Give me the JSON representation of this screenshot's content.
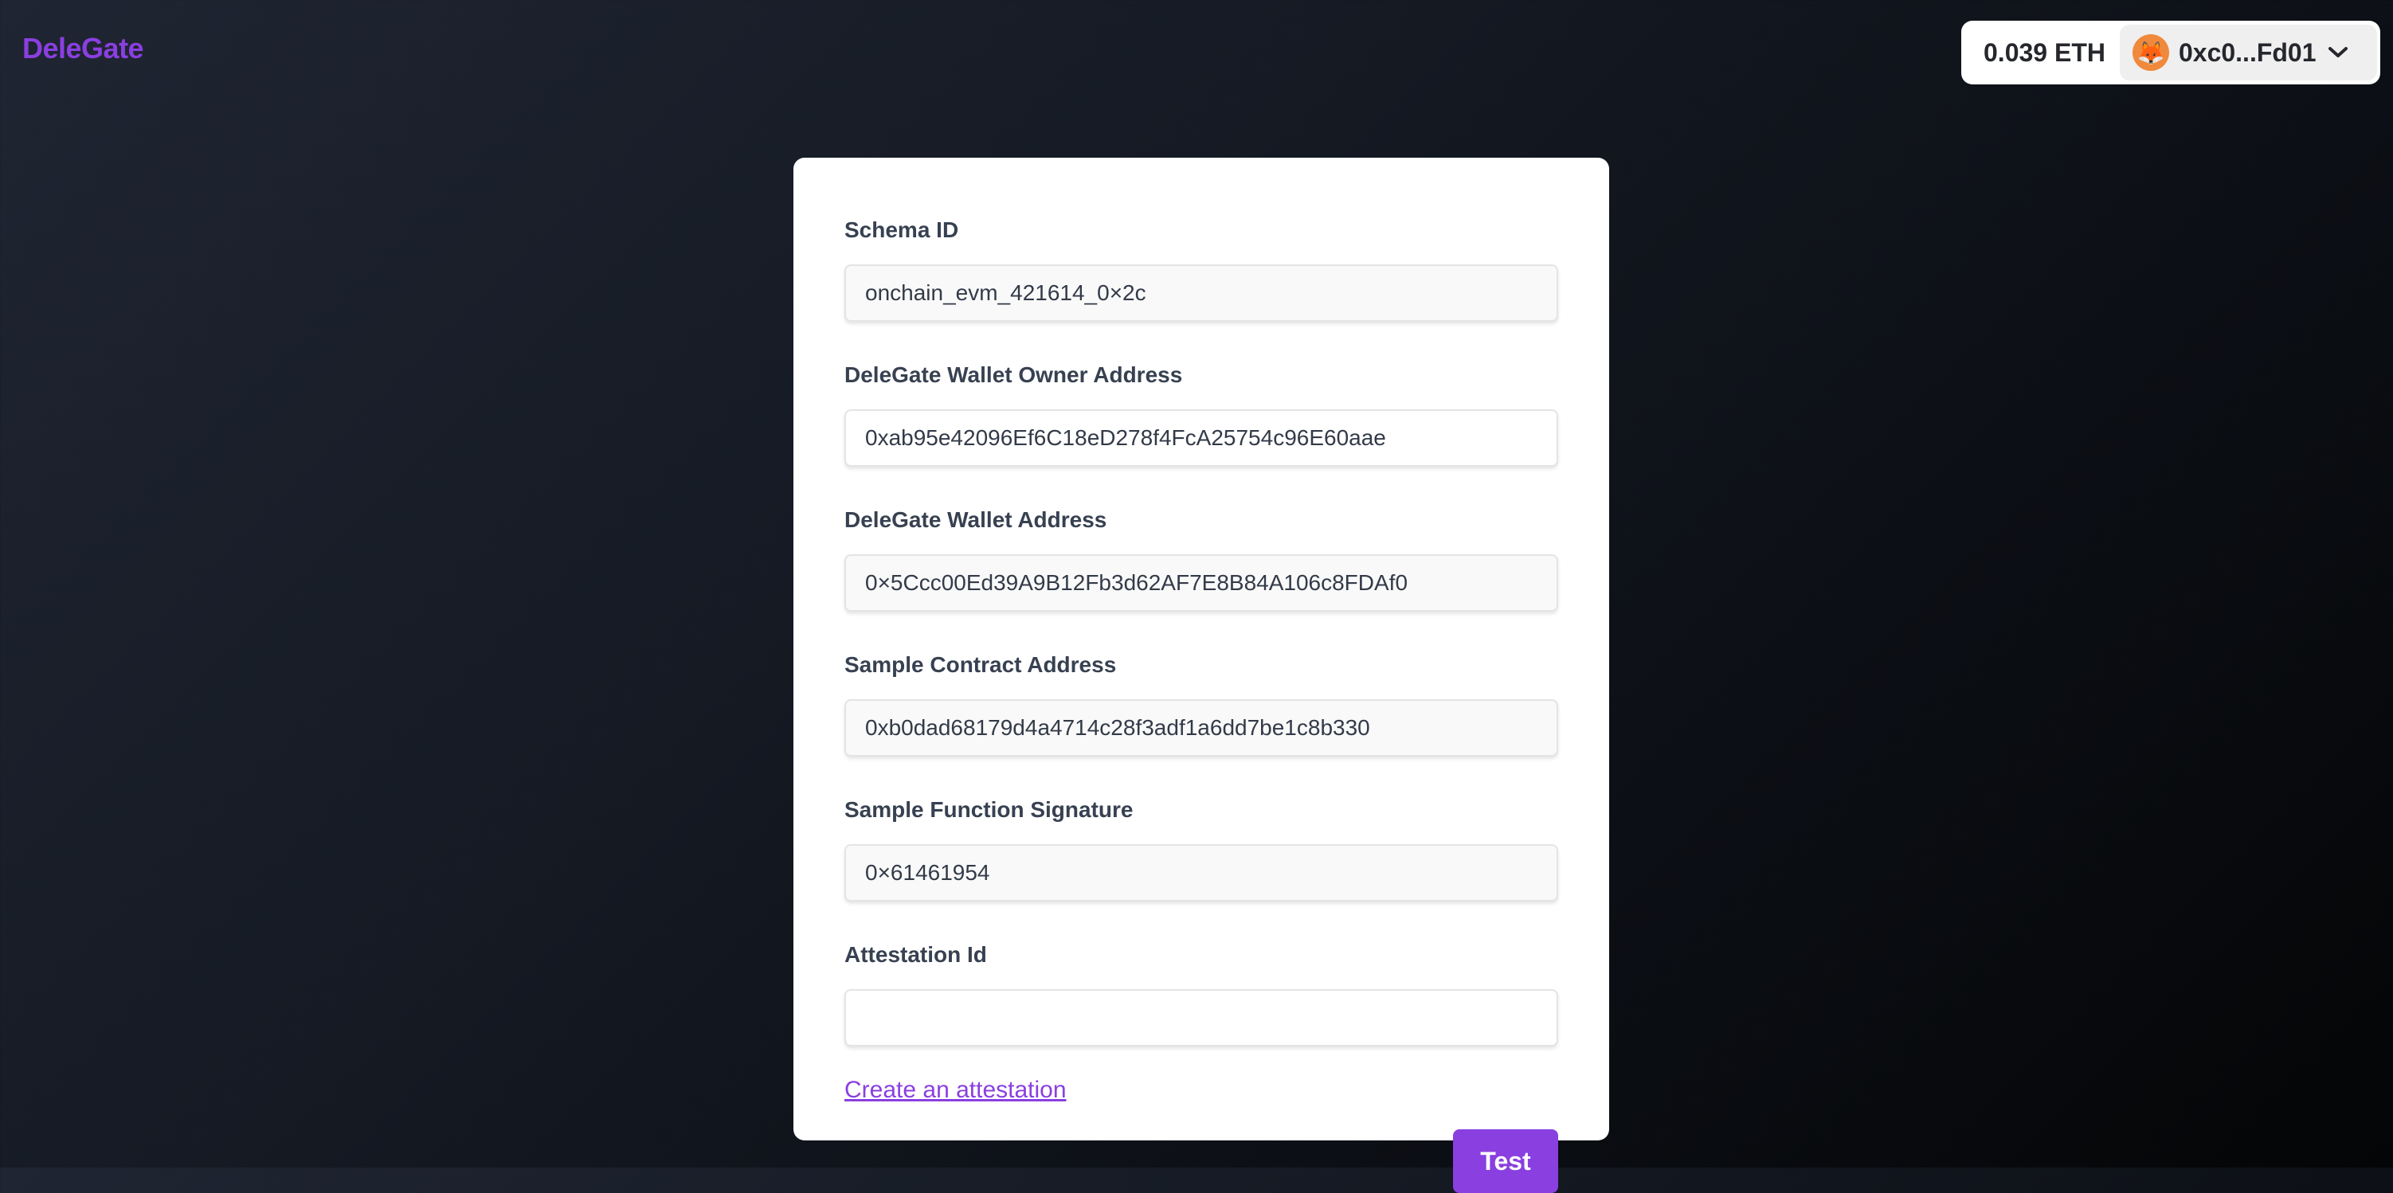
{
  "header": {
    "logo": "DeleGate",
    "wallet": {
      "balance": "0.039 ETH",
      "avatar_emoji": "🦊",
      "address": "0xc0...Fd01",
      "dropdown_icon": "chevron-down-icon"
    }
  },
  "form": {
    "fields": [
      {
        "label": "Schema ID",
        "value": "onchain_evm_421614_0×2c",
        "readonly": true
      },
      {
        "label": "DeleGate Wallet Owner Address",
        "value": "0xab95e42096Ef6C18eD278f4FcA25754c96E60aae",
        "readonly": false
      },
      {
        "label": "DeleGate Wallet Address",
        "value": "0×5Ccc00Ed39A9B12Fb3d62AF7E8B84A106c8FDAf0",
        "readonly": true
      },
      {
        "label": "Sample Contract Address",
        "value": "0xb0dad68179d4a4714c28f3adf1a6dd7be1c8b330",
        "readonly": true
      },
      {
        "label": "Sample Function Signature",
        "value": "0×61461954",
        "readonly": true
      },
      {
        "label": "Attestation Id",
        "value": "",
        "readonly": false
      }
    ],
    "create_link": "Create an attestation",
    "submit_label": "Test"
  },
  "colors": {
    "accent": "#8a3fe0",
    "label": "#374151",
    "avatar_bg": "#f0893c"
  }
}
